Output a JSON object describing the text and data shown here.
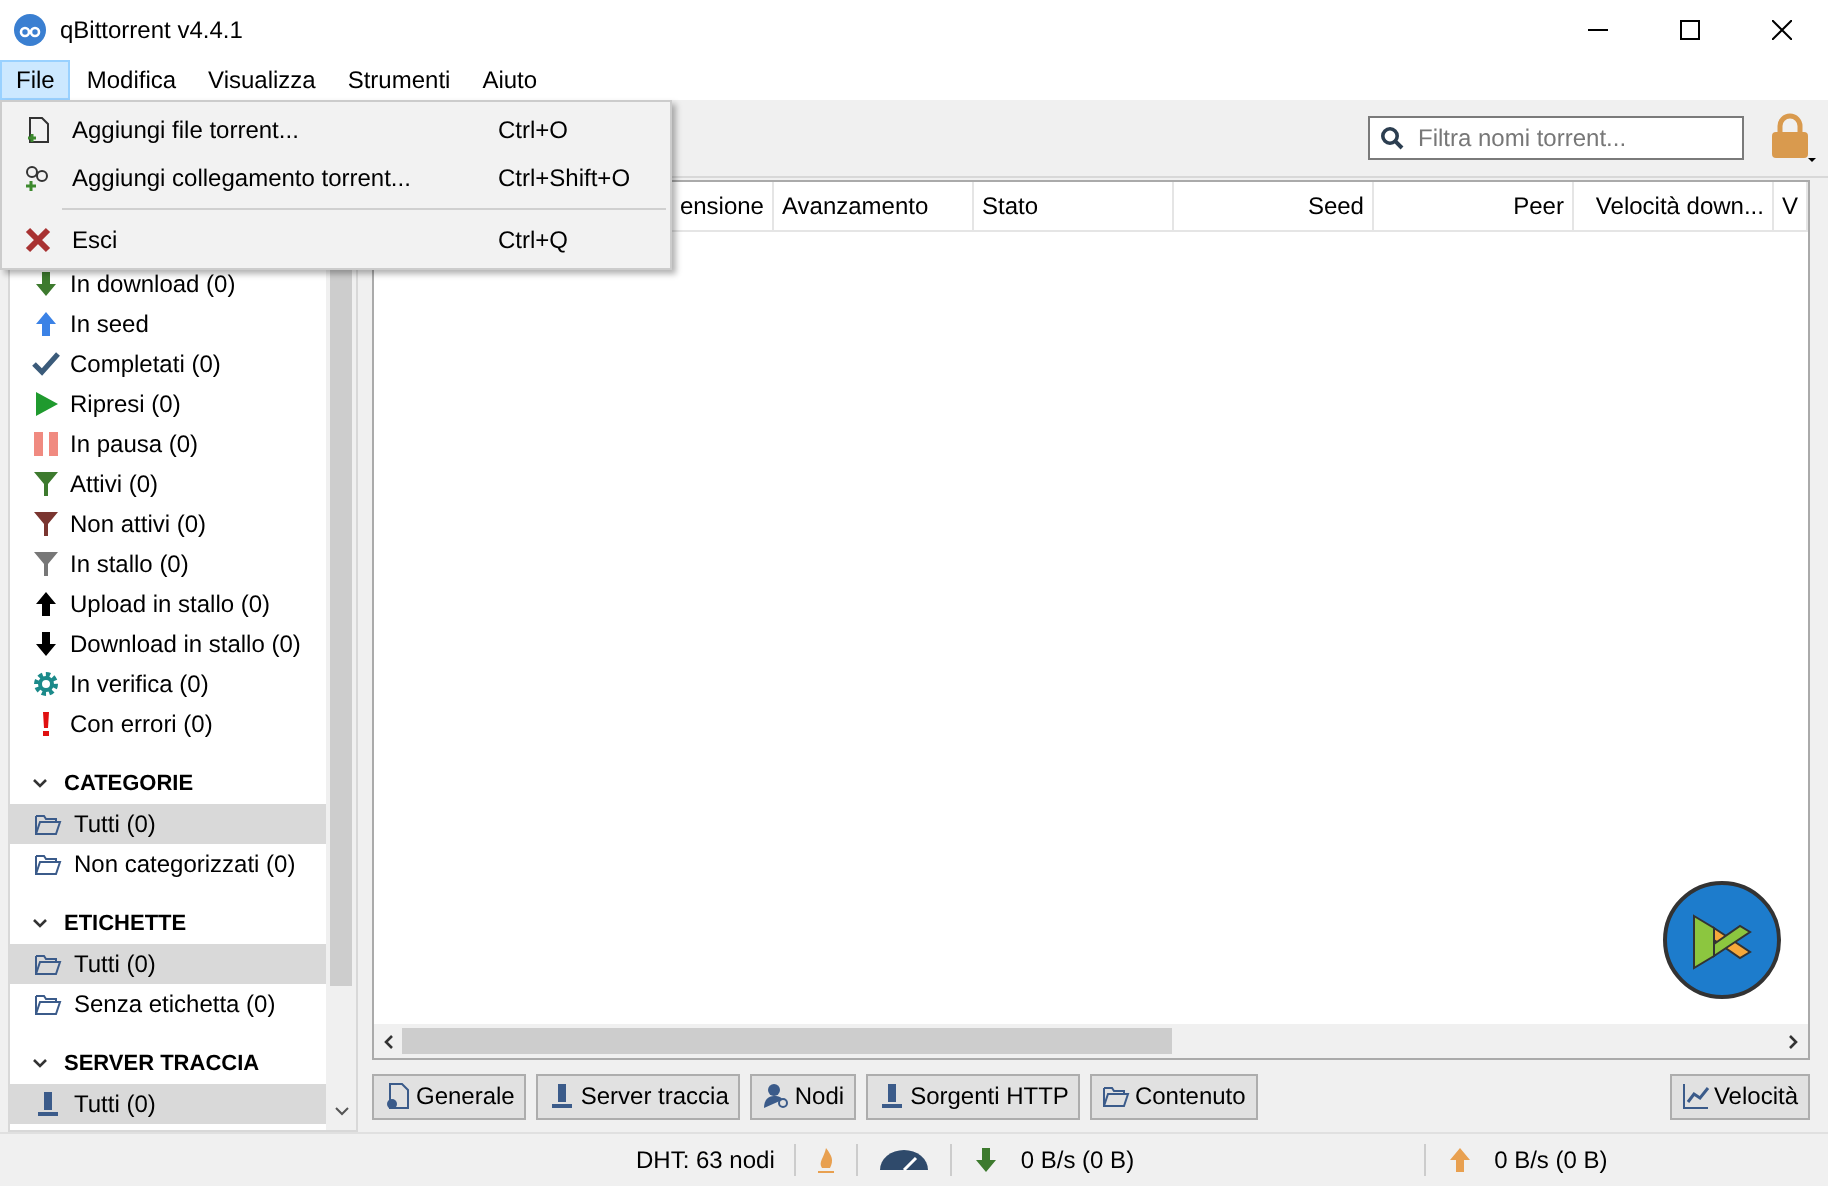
{
  "window": {
    "title": "qBittorrent v4.4.1"
  },
  "menubar": [
    {
      "label": "File",
      "selected": true
    },
    {
      "label": "Modifica",
      "selected": false
    },
    {
      "label": "Visualizza",
      "selected": false
    },
    {
      "label": "Strumenti",
      "selected": false
    },
    {
      "label": "Aiuto",
      "selected": false
    }
  ],
  "file_menu": [
    {
      "kind": "file",
      "label": "Aggiungi file torrent...",
      "shortcut": "Ctrl+O"
    },
    {
      "kind": "link",
      "label": "Aggiungi collegamento torrent...",
      "shortcut": "Ctrl+Shift+O"
    },
    {
      "kind": "separator"
    },
    {
      "kind": "exit",
      "label": "Esci",
      "shortcut": "Ctrl+Q"
    }
  ],
  "search": {
    "placeholder": "Filtra nomi torrent..."
  },
  "table": {
    "columns": [
      {
        "label": "ensione",
        "kind": "number"
      },
      {
        "label": "Avanzamento",
        "kind": "text"
      },
      {
        "label": "Stato",
        "kind": "text"
      },
      {
        "label": "Seed",
        "kind": "number"
      },
      {
        "label": "Peer",
        "kind": "number"
      },
      {
        "label": "Velocità down...",
        "kind": "number"
      },
      {
        "label": "V",
        "kind": "text"
      }
    ]
  },
  "status_filters": [
    {
      "kind": "download",
      "label": "In download (0)"
    },
    {
      "kind": "seed",
      "label": "In seed"
    },
    {
      "kind": "check",
      "label": "Completati (0)"
    },
    {
      "kind": "play",
      "label": "Ripresi (0)"
    },
    {
      "kind": "pause",
      "label": "In pausa (0)"
    },
    {
      "kind": "filter-green",
      "label": "Attivi (0)"
    },
    {
      "kind": "filter-red",
      "label": "Non attivi (0)"
    },
    {
      "kind": "filter-grey",
      "label": "In stallo (0)"
    },
    {
      "kind": "up-black",
      "label": "Upload in stallo (0)"
    },
    {
      "kind": "down-black",
      "label": "Download in stallo (0)"
    },
    {
      "kind": "gear",
      "label": "In verifica (0)"
    },
    {
      "kind": "error",
      "label": "Con errori (0)"
    }
  ],
  "sections": [
    {
      "title": "CATEGORIE",
      "items": [
        {
          "kind": "folder",
          "label": "Tutti (0)",
          "selected": true
        },
        {
          "kind": "folder",
          "label": "Non categorizzati (0)",
          "selected": false
        }
      ]
    },
    {
      "title": "ETICHETTE",
      "items": [
        {
          "kind": "folder",
          "label": "Tutti (0)",
          "selected": true
        },
        {
          "kind": "folder",
          "label": "Senza etichetta (0)",
          "selected": false
        }
      ]
    },
    {
      "title": "SERVER TRACCIA",
      "items": [
        {
          "kind": "server",
          "label": "Tutti (0)",
          "selected": true
        }
      ]
    }
  ],
  "bottom_tabs": [
    {
      "kind": "doc",
      "label": "Generale"
    },
    {
      "kind": "server",
      "label": "Server traccia"
    },
    {
      "kind": "user",
      "label": "Nodi"
    },
    {
      "kind": "server",
      "label": "Sorgenti HTTP"
    },
    {
      "kind": "folder",
      "label": "Contenuto"
    }
  ],
  "speed_tab": {
    "label": "Velocità"
  },
  "status_bar": {
    "dht": "DHT: 63 nodi",
    "download": "0 B/s (0 B)",
    "upload": "0 B/s (0 B)"
  }
}
